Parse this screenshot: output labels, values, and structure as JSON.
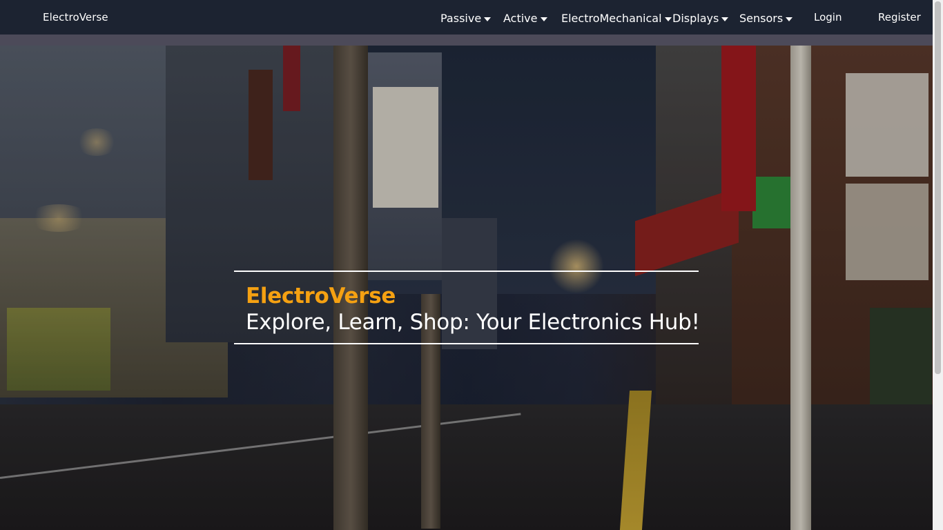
{
  "navbar": {
    "brand": "ElectroVerse",
    "menu": [
      {
        "label": "Passive"
      },
      {
        "label": "Active"
      },
      {
        "label": "ElectroMechanical"
      },
      {
        "label": "Displays"
      },
      {
        "label": "Sensors"
      }
    ],
    "login_label": "Login",
    "register_label": "Register"
  },
  "hero": {
    "title": "ElectroVerse",
    "subtitle": "Explore, Learn, Shop: Your Electronics Hub!"
  },
  "colors": {
    "navbar_bg": "#1c2331",
    "accent": "#f5a112",
    "text": "#ffffff"
  }
}
